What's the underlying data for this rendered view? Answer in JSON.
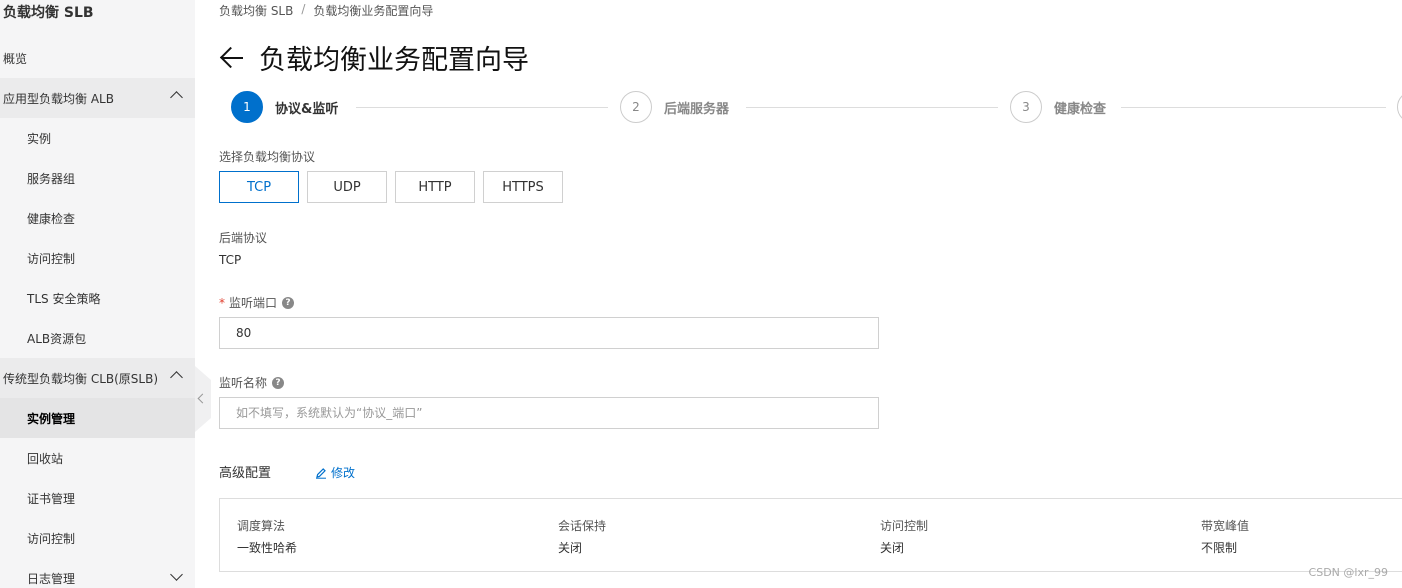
{
  "sidebar": {
    "title": "负载均衡 SLB",
    "items": [
      {
        "label": "概览"
      },
      {
        "label": "应用型负载均衡 ALB"
      },
      {
        "label": "实例"
      },
      {
        "label": "服务器组"
      },
      {
        "label": "健康检查"
      },
      {
        "label": "访问控制"
      },
      {
        "label": "TLS 安全策略"
      },
      {
        "label": "ALB资源包"
      },
      {
        "label": "传统型负载均衡 CLB(原SLB)"
      },
      {
        "label": "实例管理"
      },
      {
        "label": "回收站"
      },
      {
        "label": "证书管理"
      },
      {
        "label": "访问控制"
      },
      {
        "label": "日志管理"
      }
    ]
  },
  "breadcrumb": {
    "items": [
      "负载均衡 SLB",
      "负载均衡业务配置向导"
    ],
    "separator": "/"
  },
  "page": {
    "title": "负载均衡业务配置向导"
  },
  "steps": [
    {
      "number": "1",
      "label": "协议&监听",
      "active": true
    },
    {
      "number": "2",
      "label": "后端服务器",
      "active": false
    },
    {
      "number": "3",
      "label": "健康检查",
      "active": false
    }
  ],
  "form": {
    "protocol_label": "选择负载均衡协议",
    "protocols": [
      "TCP",
      "UDP",
      "HTTP",
      "HTTPS"
    ],
    "selected_protocol": "TCP",
    "backend_protocol_label": "后端协议",
    "backend_protocol_value": "TCP",
    "listen_port_required_mark": "*",
    "listen_port_label": "监听端口",
    "listen_port_value": "80",
    "listen_name_label": "监听名称",
    "listen_name_placeholder": "如不填写，系统默认为“协议_端口”",
    "help_glyph": "?"
  },
  "advanced": {
    "title": "高级配置",
    "edit_label": "修改",
    "settings": [
      {
        "key": "调度算法",
        "value": "一致性哈希"
      },
      {
        "key": "会话保持",
        "value": "关闭"
      },
      {
        "key": "访问控制",
        "value": "关闭"
      },
      {
        "key": "带宽峰值",
        "value": "不限制"
      }
    ]
  },
  "watermark": "CSDN @lxr_99",
  "colors": {
    "accent": "#0070cc",
    "sidebar_bg": "#f5f5f6",
    "required": "#e03e2d"
  }
}
